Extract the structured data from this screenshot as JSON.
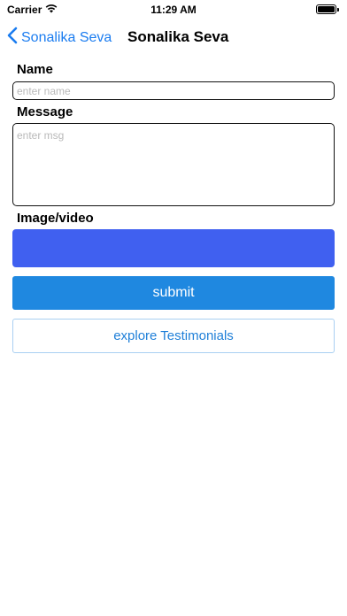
{
  "status_bar": {
    "carrier": "Carrier",
    "time": "11:29 AM"
  },
  "nav": {
    "back_label": "Sonalika Seva",
    "title": "Sonalika Seva"
  },
  "form": {
    "name_label": "Name",
    "name_placeholder": "enter name",
    "message_label": "Message",
    "message_placeholder": "enter msg",
    "media_label": "Image/video",
    "media_button_color": "#4060f0",
    "submit_label": "submit",
    "explore_label": "explore Testimonials"
  },
  "colors": {
    "accent": "#1a7cf0",
    "submit_bg": "#1f88e0",
    "explore_text": "#1f7fd8"
  }
}
